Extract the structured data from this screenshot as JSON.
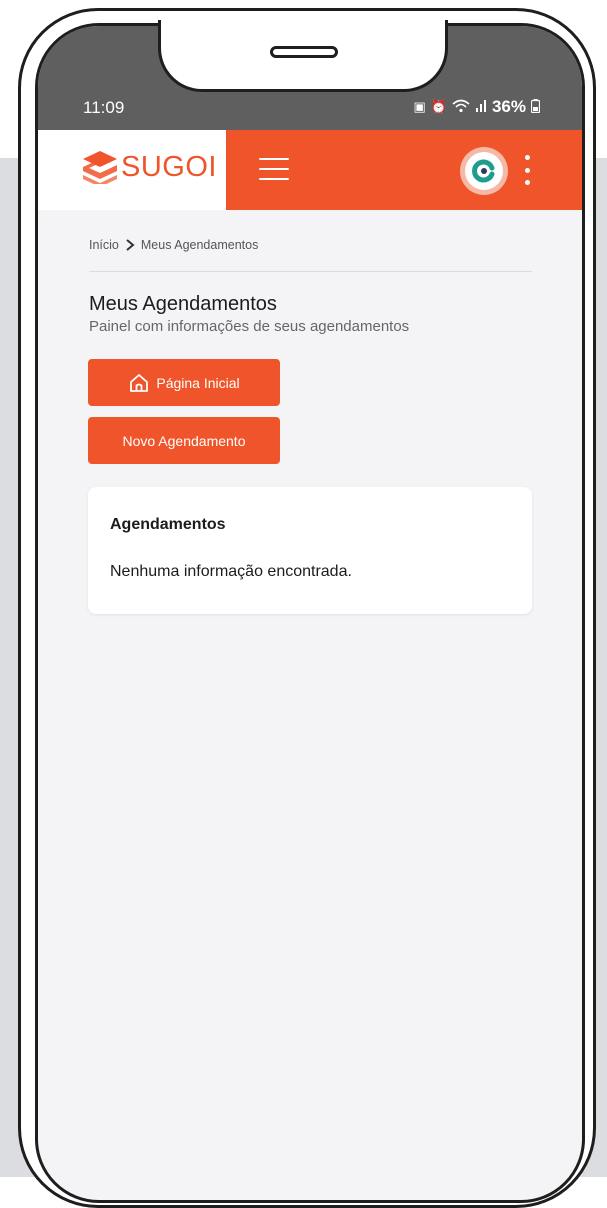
{
  "status_bar": {
    "time": "11:09",
    "battery": "36%"
  },
  "app_bar": {
    "logo_text": "SUGOI",
    "accent_color": "#ef542a"
  },
  "breadcrumb": {
    "home": "Início",
    "current": "Meus Agendamentos"
  },
  "page": {
    "title": "Meus Agendamentos",
    "subtitle": "Painel com informações de seus agendamentos"
  },
  "buttons": {
    "home_label": "Página Inicial",
    "new_label": "Novo Agendamento"
  },
  "card": {
    "title": "Agendamentos",
    "empty_text": "Nenhuma informação encontrada."
  },
  "icons": [
    "home-icon",
    "menu-icon",
    "more-vertical-icon",
    "chevron-right-icon",
    "avatar-icon",
    "wifi-icon",
    "signal-icon",
    "battery-icon",
    "alarm-icon"
  ]
}
